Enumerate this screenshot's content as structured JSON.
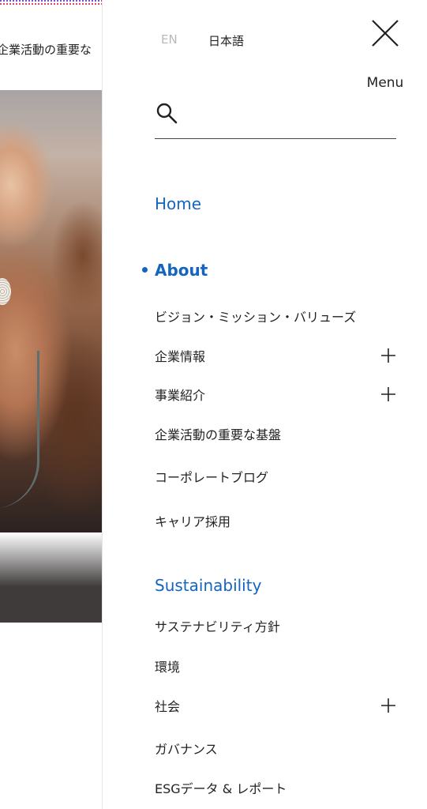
{
  "background": {
    "heading": "企業活動の重要な"
  },
  "header": {
    "lang_en": "EN",
    "lang_ja": "日本語",
    "close_label": "Menu"
  },
  "search": {
    "value": "",
    "placeholder": ""
  },
  "nav": {
    "home": "Home",
    "about": {
      "title": "About",
      "items": [
        "ビジョン・ミッション・バリューズ",
        "企業情報",
        "事業紹介",
        "企業活動の重要な基盤",
        "コーポレートブログ",
        "キャリア採用"
      ]
    },
    "sustainability": {
      "title": "Sustainability",
      "items": [
        "サステナビリティ方針",
        "環境",
        "社会",
        "ガバナンス",
        "ESGデータ & レポート"
      ]
    }
  },
  "colors": {
    "accent": "#1565c0",
    "text": "#222222",
    "muted": "#b9b9b9"
  },
  "icons": {
    "close": "close-icon",
    "search": "search-icon",
    "expand": "plus-icon"
  }
}
